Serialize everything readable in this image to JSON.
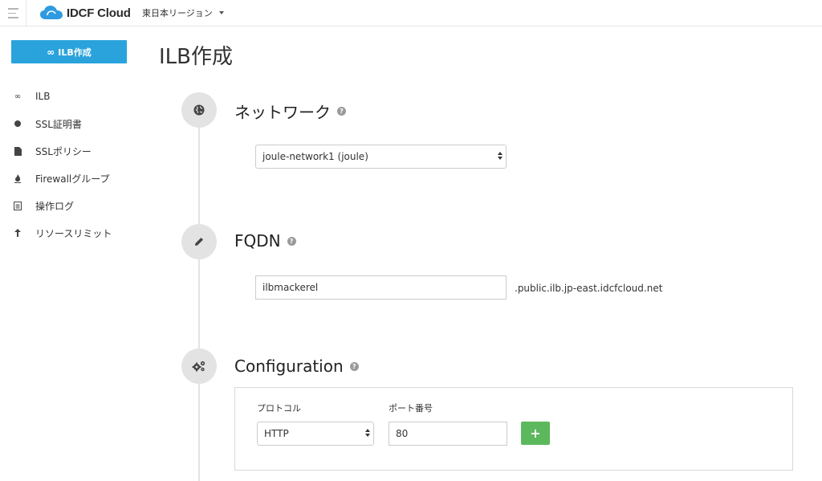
{
  "header": {
    "logo_text": "IDCF Cloud",
    "region": "東日本リージョン"
  },
  "sidebar": {
    "create_button": "ILB作成",
    "items": [
      {
        "label": "ILB",
        "icon": "infinity-icon"
      },
      {
        "label": "SSL証明書",
        "icon": "badge-icon"
      },
      {
        "label": "SSLポリシー",
        "icon": "file-icon"
      },
      {
        "label": "Firewallグループ",
        "icon": "fire-icon"
      },
      {
        "label": "操作ログ",
        "icon": "document-icon"
      },
      {
        "label": "リソースリミット",
        "icon": "arrow-up-icon"
      }
    ]
  },
  "main": {
    "title": "ILB作成",
    "network": {
      "title": "ネットワーク",
      "selected": "joule-network1 (joule)"
    },
    "fqdn": {
      "title": "FQDN",
      "value": "ilbmackerel",
      "suffix": ".public.ilb.jp-east.idcfcloud.net"
    },
    "configuration": {
      "title": "Configuration",
      "protocol_label": "プロトコル",
      "protocol_value": "HTTP",
      "port_label": "ポート番号",
      "port_value": "80",
      "add_label": "+"
    }
  },
  "colors": {
    "accent": "#2aa3dc",
    "add_button": "#5cb85c",
    "timeline": "#e3e3e3"
  }
}
